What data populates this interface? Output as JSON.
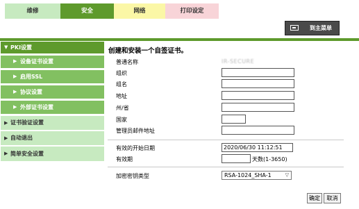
{
  "tabs": {
    "maintenance": "维修",
    "security": "安全",
    "network": "网络",
    "print_settings": "打印设定"
  },
  "home_button": {
    "label": "到主菜单",
    "icon": "home-screen-icon"
  },
  "sidebar": {
    "pki_settings": "PKI设置",
    "device_cert_settings": "设备证书设置",
    "enable_ssl": "启用SSL",
    "protocol_settings": "协议设置",
    "external_cert_settings": "外部证书设置",
    "cert_verification": "证书验证设置",
    "auto_logout": "自动退出",
    "simple_security": "简单安全设置"
  },
  "form": {
    "title": "创建和安装一个自签证书。",
    "common_name_label": "普通名称",
    "common_name_value": "IR-SECURE",
    "organization_label": "组织",
    "org_unit_label": "组名",
    "address_label": "地址",
    "state_label": "州/省",
    "country_label": "国家",
    "admin_email_label": "管理员邮件地址",
    "valid_start_label": "有效的开始日期",
    "valid_start_value": "2020/06/30 11:12:51",
    "validity_label": "有效期",
    "validity_unit": "天数(1-3650)",
    "key_type_label": "加密密钥类型",
    "key_type_value": "RSA-1024_SHA-1"
  },
  "buttons": {
    "ok": "确定",
    "cancel": "取消"
  }
}
